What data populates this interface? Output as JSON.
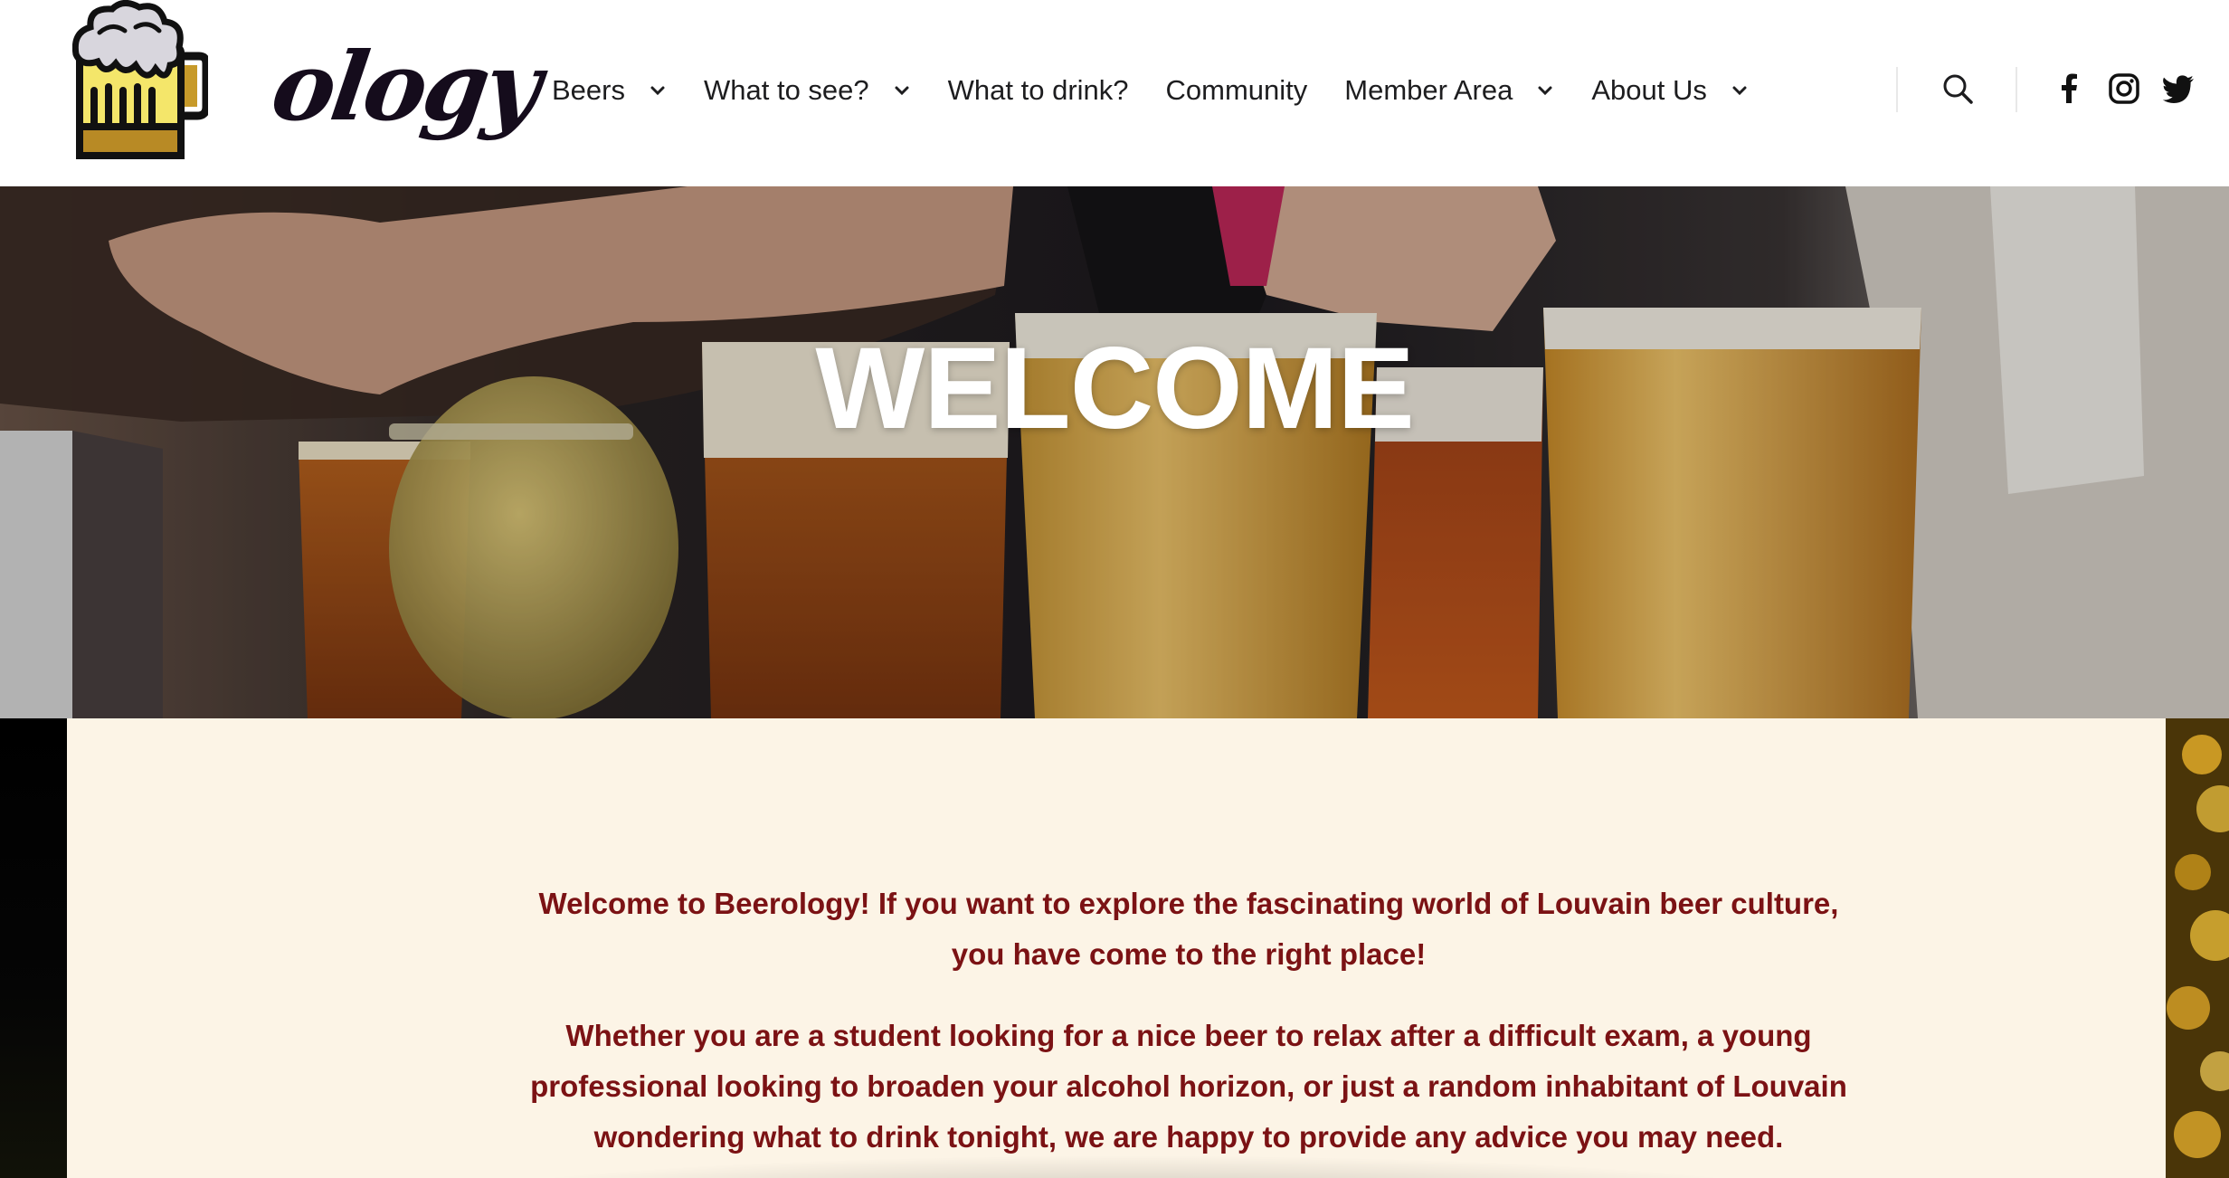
{
  "brand": {
    "logo_text": "ology",
    "logo_icon": "beer-mug-icon"
  },
  "nav": {
    "items": [
      {
        "label": "Beers",
        "has_dropdown": true
      },
      {
        "label": "What to see?",
        "has_dropdown": true
      },
      {
        "label": "What to drink?",
        "has_dropdown": false
      },
      {
        "label": "Community",
        "has_dropdown": false
      },
      {
        "label": "Member Area",
        "has_dropdown": true
      },
      {
        "label": "About Us",
        "has_dropdown": true
      }
    ]
  },
  "header_icons": {
    "search": "search-icon",
    "facebook": "facebook-icon",
    "instagram": "instagram-icon",
    "twitter": "twitter-icon"
  },
  "hero": {
    "title": "WELCOME",
    "image": "beer-glasses-photo"
  },
  "content": {
    "paragraph1": "Welcome to Beerology! If you want to explore the fascinating world of Louvain beer culture, you have come to the right place!",
    "paragraph2": "Whether you are a student looking for a nice beer to relax after a difficult exam, a young professional looking to broaden your alcohol horizon, or just a random inhabitant of Louvain wondering what to drink tonight, we are happy to provide any advice you may need."
  },
  "colors": {
    "accent_text": "#7b1214",
    "panel_bg": "#fcf4e6",
    "nav_text": "#1d1d1f"
  }
}
